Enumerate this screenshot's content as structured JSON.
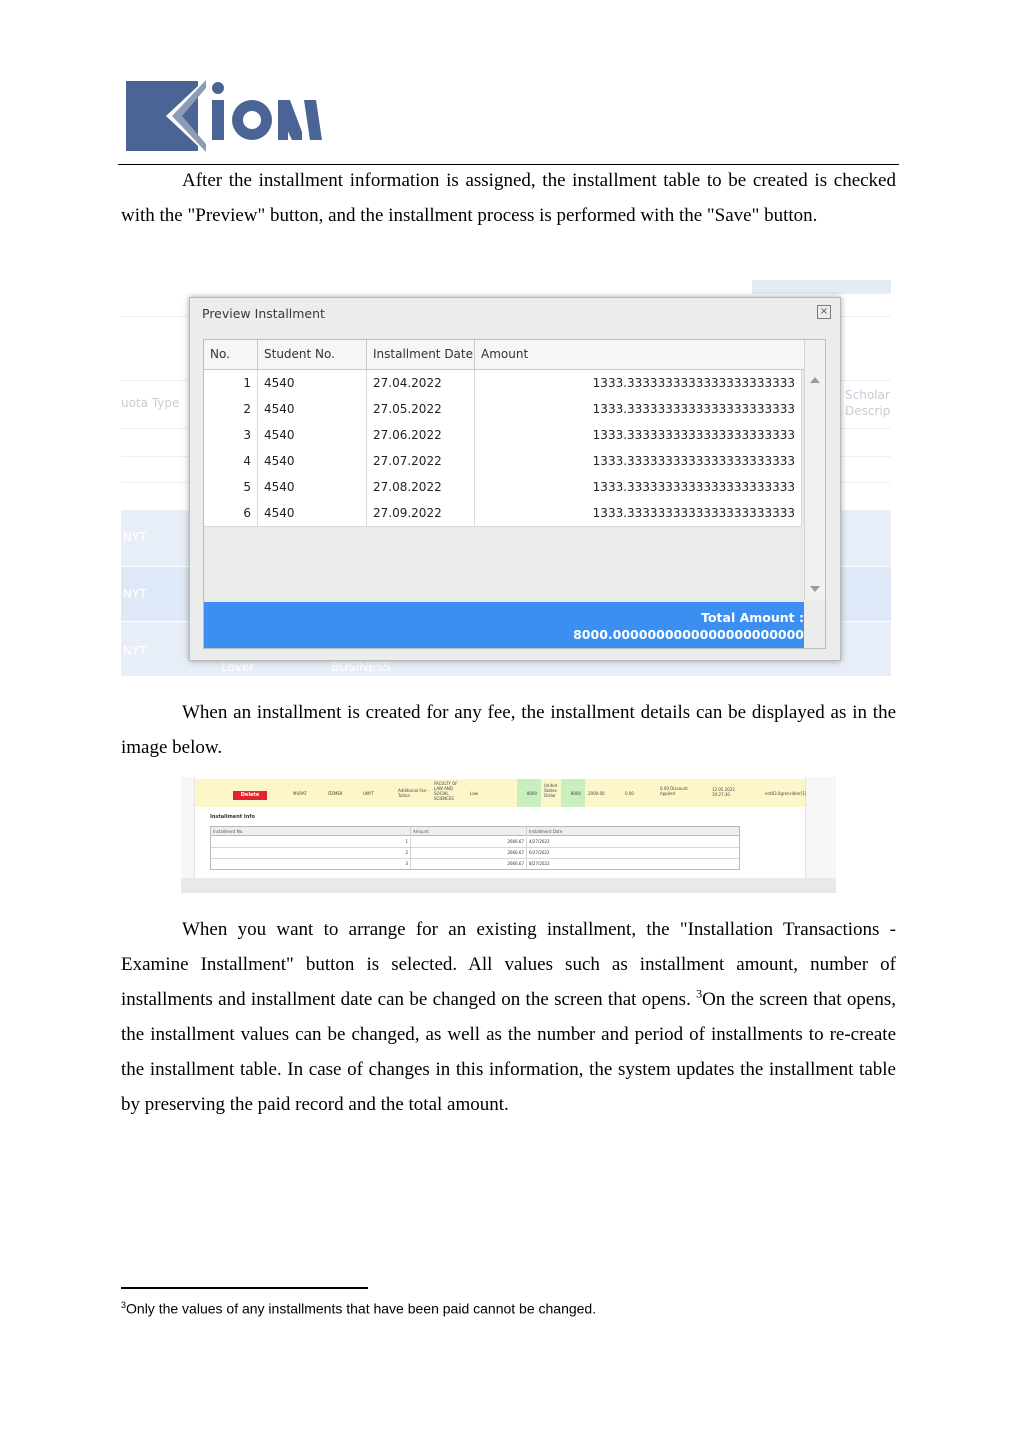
{
  "logo": {
    "text": "Kion",
    "colors": {
      "primary": "#4a6496",
      "shadow": "#8e9bb5"
    }
  },
  "paragraphs": {
    "p1": "After the installment information is assigned, the installment table to be created is checked with the \"Preview\" button, and the installment process is performed with the \"Save\" button.",
    "p2": "When an installment is created for any fee, the installment details can be displayed as in the image below.",
    "p3_before": "When you want to arrange for an existing installment, the \"Installation Transactions - Examine Installment\" button is selected. All values such as installment amount, number of installments and installment date can be changed on the screen that opens. ",
    "p3_sup": "3",
    "p3_after": "On the screen that opens, the installment values can be changed, as well as the number and period of installments to re-create the installment table. In case of changes in this information, the system updates the installment table by preserving the paid record and the total amount."
  },
  "preview_dialog": {
    "background": {
      "left_label": "uota Type",
      "right_label_1": "Scholar",
      "right_label_2": "Descrip",
      "row_labels": [
        "NYT",
        "NYT",
        "NYT"
      ],
      "bottom_labels": [
        "Lover",
        "BUSINESS"
      ]
    },
    "title": "Preview Installment",
    "close_icon": "close-x-icon",
    "columns": [
      "No.",
      "Student No.",
      "Installment Date",
      "Amount"
    ],
    "rows": [
      {
        "no": "1",
        "student_no": "4540",
        "date": "27.04.2022",
        "amount": "1333.3333333333333333333333"
      },
      {
        "no": "2",
        "student_no": "4540",
        "date": "27.05.2022",
        "amount": "1333.3333333333333333333333"
      },
      {
        "no": "3",
        "student_no": "4540",
        "date": "27.06.2022",
        "amount": "1333.3333333333333333333333"
      },
      {
        "no": "4",
        "student_no": "4540",
        "date": "27.07.2022",
        "amount": "1333.3333333333333333333333"
      },
      {
        "no": "5",
        "student_no": "4540",
        "date": "27.08.2022",
        "amount": "1333.3333333333333333333333"
      },
      {
        "no": "6",
        "student_no": "4540",
        "date": "27.09.2022",
        "amount": "1333.3333333333333333333333"
      }
    ],
    "total_label": "Total Amount :",
    "total_value": "8000.0000000000000000000000",
    "colors": {
      "total_bar": "#3a8ff0"
    }
  },
  "installment_details": {
    "fee_row": {
      "delete_label": "Delete",
      "first_name": "MURAT",
      "last_name": "ÖZMEK",
      "code": "UNYT",
      "fee_type": "Additional Fee - Tution",
      "faculty": "FACULTY OF LAW AND SOCIAL SCIENCES",
      "department": "Law",
      "amount": "8000",
      "currency": "United States Dollar",
      "amount2": "8000",
      "paid": "2000.00",
      "remaining": "0.00",
      "discount": "0.00 Discount Applied",
      "date": "12.05.2022 10:27:30",
      "user": "ent03.0grencibler[1]"
    },
    "info_title": "Installment Info",
    "columns": [
      "Installment No.",
      "Amount",
      "Installment Date"
    ],
    "rows": [
      {
        "no": "1",
        "amount": "2666.67",
        "date": "4/27/2022"
      },
      {
        "no": "2",
        "amount": "2666.67",
        "date": "6/27/2022"
      },
      {
        "no": "3",
        "amount": "2666.67",
        "date": "8/27/2022"
      }
    ]
  },
  "footnote": {
    "marker": "3",
    "text": "Only the values of any installments that have been paid cannot be changed."
  }
}
